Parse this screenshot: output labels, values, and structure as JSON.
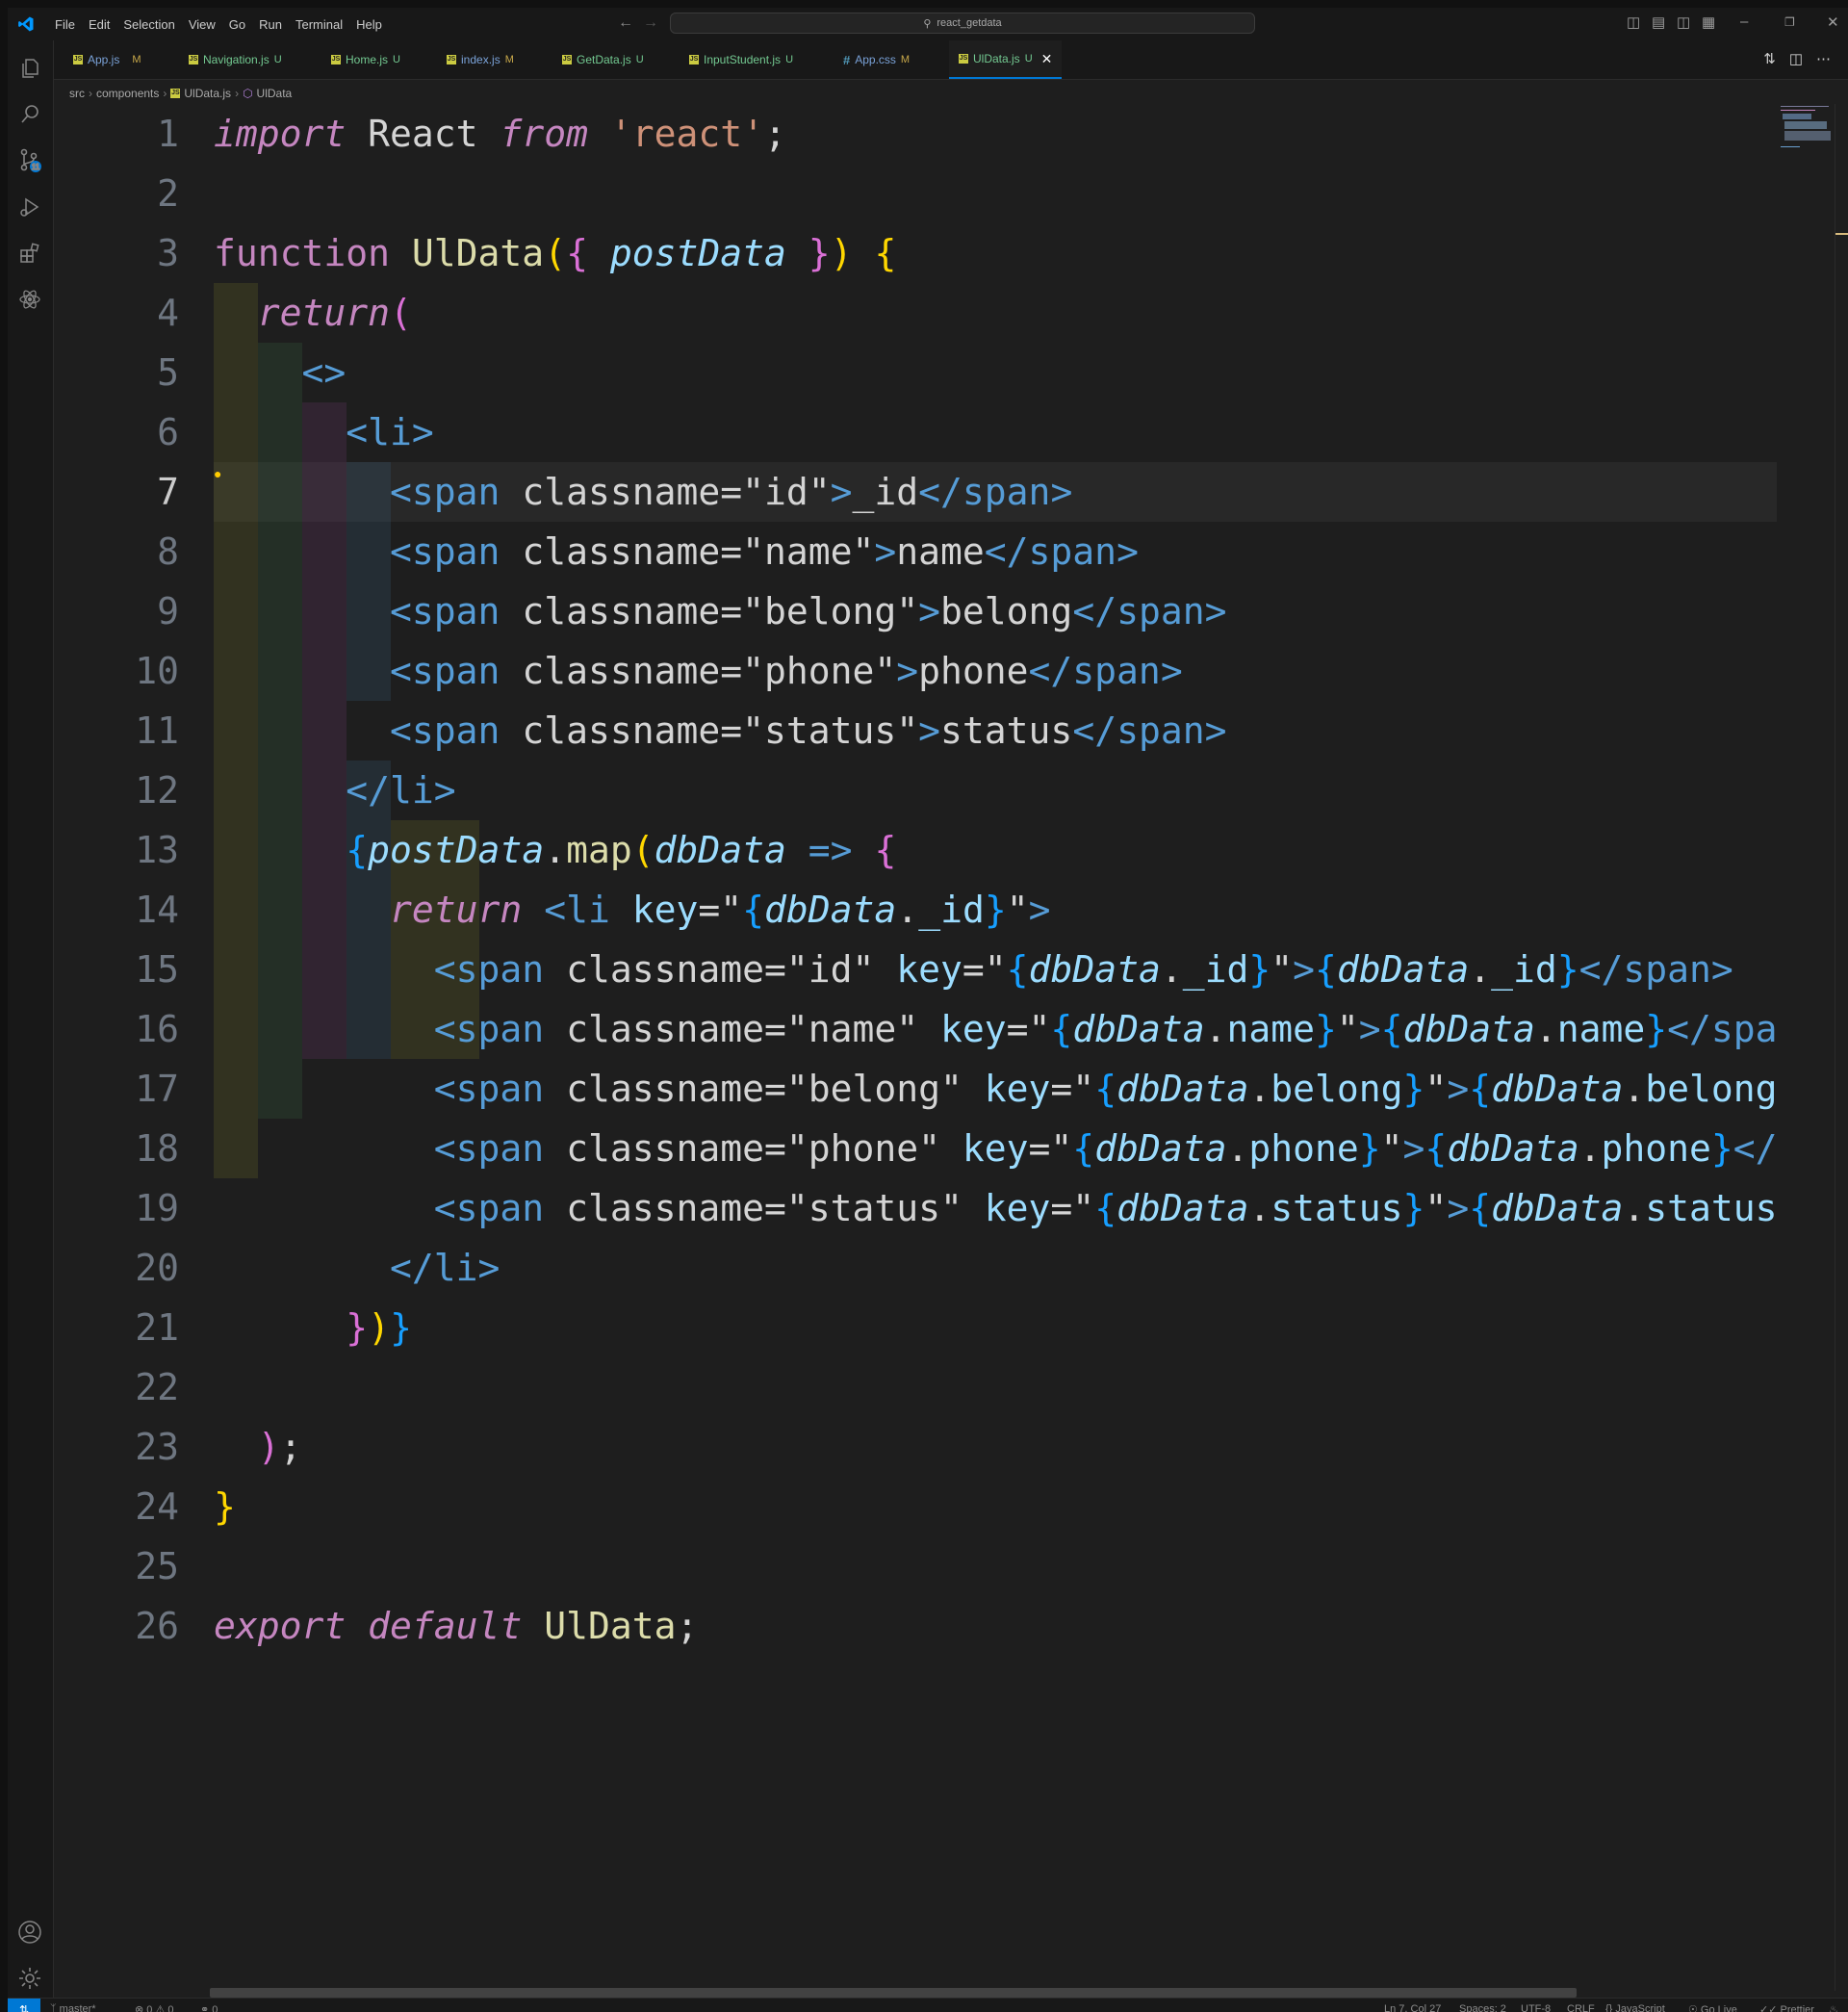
{
  "window": {
    "menu": [
      "File",
      "Edit",
      "Selection",
      "View",
      "Go",
      "Run",
      "Terminal",
      "Help"
    ],
    "search_text": "react_getdata"
  },
  "activity_bar": {
    "scm_badge": "11"
  },
  "tabs": [
    {
      "label": "App.js",
      "status": "M",
      "icon": "js"
    },
    {
      "label": "Navigation.js",
      "status": "U",
      "icon": "js"
    },
    {
      "label": "Home.js",
      "status": "U",
      "icon": "js"
    },
    {
      "label": "index.js",
      "status": "M",
      "icon": "js"
    },
    {
      "label": "GetData.js",
      "status": "U",
      "icon": "js"
    },
    {
      "label": "InputStudent.js",
      "status": "U",
      "icon": "js"
    },
    {
      "label": "App.css",
      "status": "M",
      "icon": "css"
    },
    {
      "label": "UlData.js",
      "status": "U",
      "icon": "js",
      "active": true
    }
  ],
  "breadcrumb": [
    "src",
    "components",
    "UlData.js",
    "UlData"
  ],
  "editor": {
    "current_line": 7,
    "line_numbers": [
      "1",
      "2",
      "3",
      "4",
      "5",
      "6",
      "7",
      "8",
      "9",
      "10",
      "11",
      "12",
      "13",
      "14",
      "15",
      "16",
      "17",
      "18",
      "19",
      "20",
      "21",
      "22",
      "23",
      "24",
      "25",
      "26"
    ]
  },
  "colors": {
    "accent": "#0078d4",
    "editor_bg": "#1e1e1e"
  },
  "status_bar": {
    "branch": "master*",
    "problems": "0 ⚠ 0",
    "ports": "0",
    "position": "Ln 7, Col 27",
    "spaces": "Spaces: 2",
    "encoding": "UTF-8",
    "eol": "CRLF",
    "language": "JavaScript",
    "golive": "Go Live",
    "prettier": "Prettier"
  }
}
